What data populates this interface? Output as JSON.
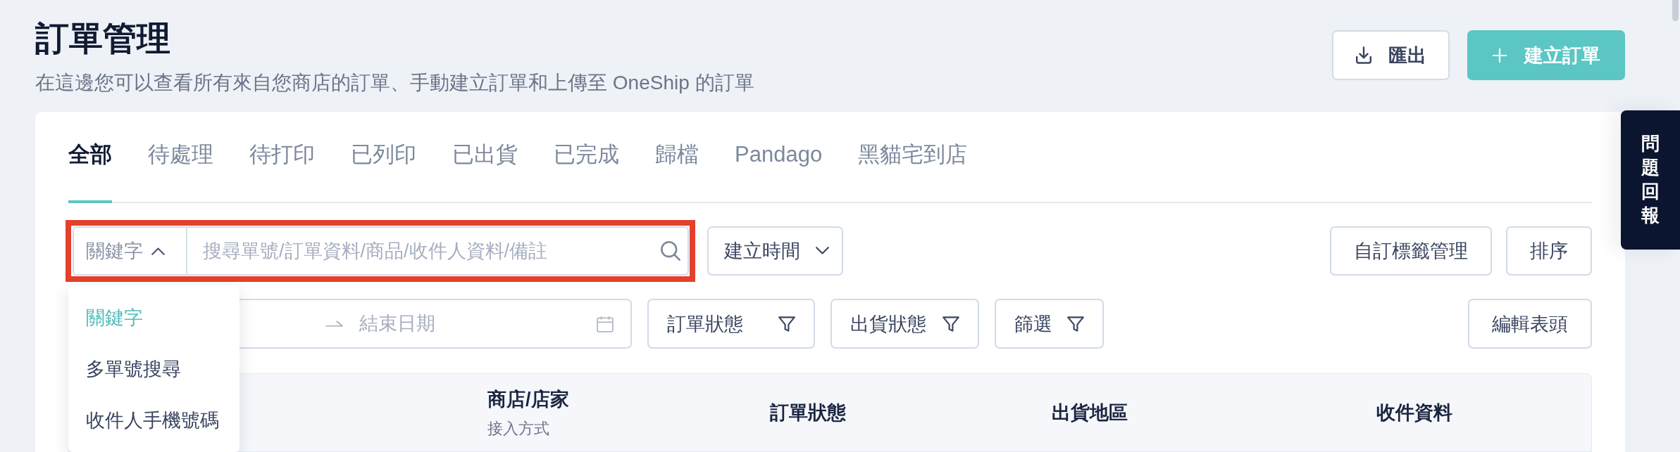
{
  "header": {
    "title": "訂單管理",
    "subtitle": "在這邊您可以查看所有來自您商店的訂單、手動建立訂單和上傳至 OneShip 的訂單",
    "actions": [
      {
        "label": "匯出",
        "kind": "export"
      },
      {
        "label": "建立訂單",
        "kind": "create"
      }
    ]
  },
  "tabs": [
    {
      "label": "全部",
      "selected": true
    },
    {
      "label": "待處理",
      "selected": false
    },
    {
      "label": "待打印",
      "selected": false
    },
    {
      "label": "已列印",
      "selected": false
    },
    {
      "label": "已出貨",
      "selected": false
    },
    {
      "label": "已完成",
      "selected": false
    },
    {
      "label": "歸檔",
      "selected": false
    },
    {
      "label": "Pandago",
      "selected": false
    },
    {
      "label": "黑貓宅到店",
      "selected": false
    }
  ],
  "search": {
    "highlighted": true,
    "field_select": {
      "value": "關鍵字",
      "expanded": true
    },
    "placeholder": "搜尋單號/訂單資料/商品/收件人資料/備註",
    "options": [
      {
        "label": "關鍵字",
        "selected": true
      },
      {
        "label": "多單號搜尋",
        "selected": false
      },
      {
        "label": "收件人手機號碼",
        "selected": false
      }
    ]
  },
  "date_sort": {
    "label": "建立時間"
  },
  "toolbar_right": [
    "自訂標籤管理",
    "排序"
  ],
  "date_range": {
    "end_placeholder": "結束日期"
  },
  "filters": [
    {
      "label": "訂單狀態"
    },
    {
      "label": "出貨狀態"
    },
    {
      "label": "篩選"
    }
  ],
  "edit_columns": {
    "label": "編輯表頭"
  },
  "table": {
    "columns": [
      {
        "label": "商店/店家",
        "sublabel": "接入方式"
      },
      {
        "label": "訂單狀態"
      },
      {
        "label": "出貨地區"
      },
      {
        "label": "收件資料"
      }
    ]
  },
  "feedback_tab": {
    "label": "問題回報"
  }
}
